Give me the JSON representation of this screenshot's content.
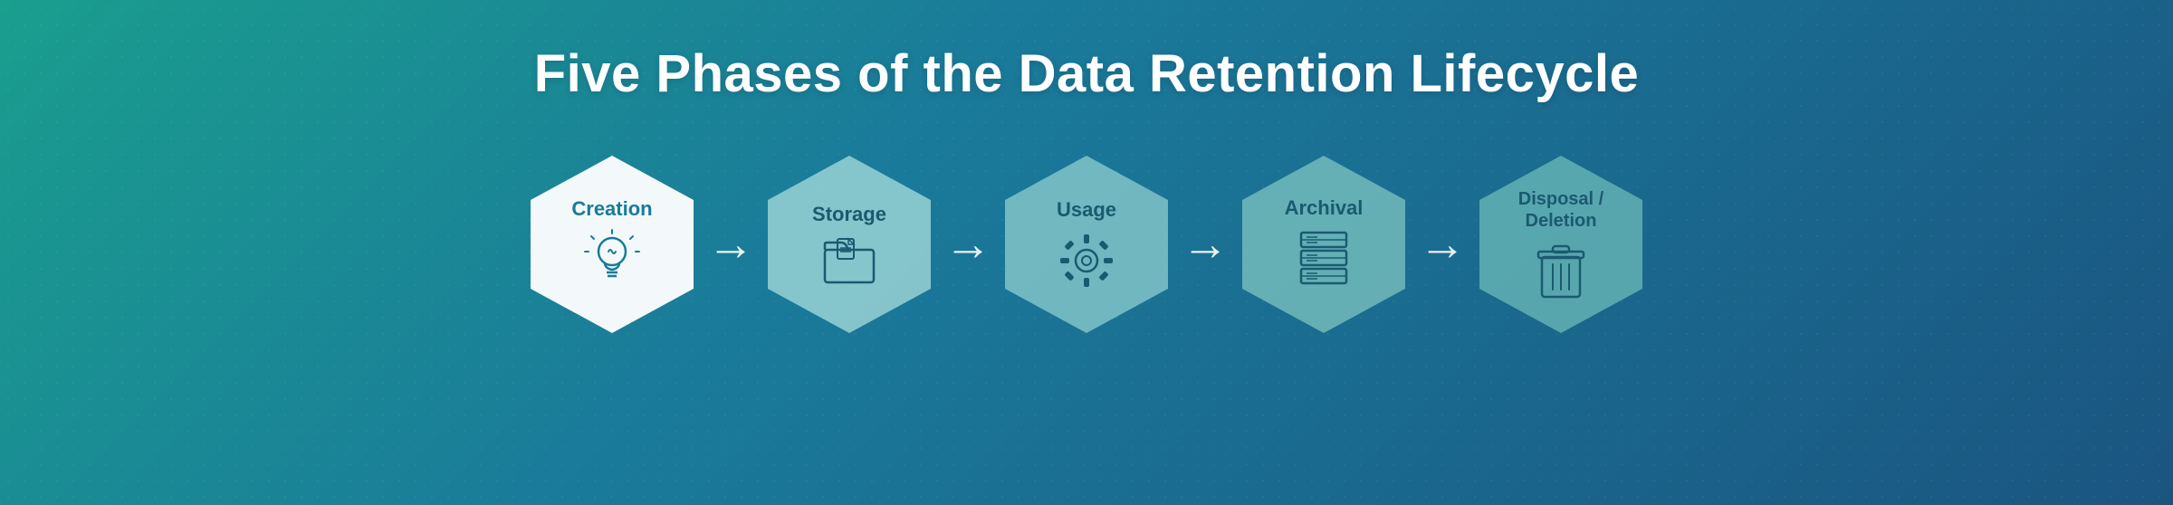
{
  "title": "Five Phases of the Data Retention Lifecycle",
  "phases": [
    {
      "id": "creation",
      "label": "Creation",
      "label_multiline": false,
      "icon": "lightbulb",
      "style": "creation"
    },
    {
      "id": "storage",
      "label": "Storage",
      "label_multiline": false,
      "icon": "folder",
      "style": "other"
    },
    {
      "id": "usage",
      "label": "Usage",
      "label_multiline": false,
      "icon": "gear",
      "style": "other"
    },
    {
      "id": "archival",
      "label": "Archival",
      "label_multiline": false,
      "icon": "database",
      "style": "other"
    },
    {
      "id": "disposal",
      "label": "Disposal / Deletion",
      "label_multiline": true,
      "icon": "trash",
      "style": "other"
    }
  ],
  "arrow_symbol": "→"
}
